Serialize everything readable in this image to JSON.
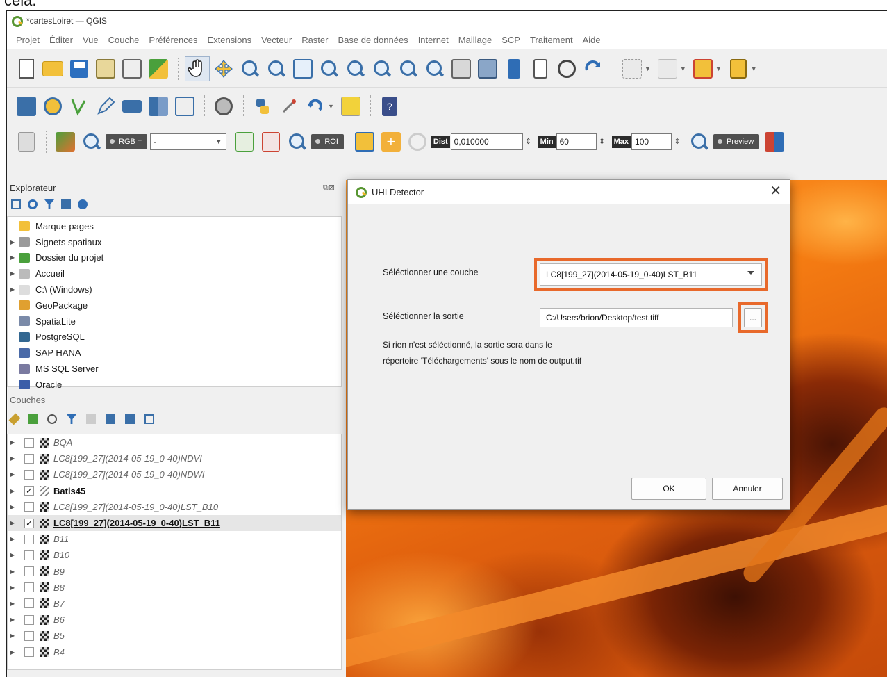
{
  "caption": "cela.",
  "window": {
    "title": "*cartesLoiret — QGIS"
  },
  "menubar": [
    "Projet",
    "Éditer",
    "Vue",
    "Couche",
    "Préférences",
    "Extensions",
    "Vecteur",
    "Raster",
    "Base de données",
    "Internet",
    "Maillage",
    "SCP",
    "Traitement",
    "Aide"
  ],
  "scp_toolbar": {
    "rgb_label": "RGB =",
    "rgb_value": "-",
    "roi_label": "ROI",
    "dist_label": "Dist",
    "dist_value": "0,010000",
    "min_label": "Min",
    "min_value": "60",
    "max_label": "Max",
    "max_value": "100",
    "preview_label": "Preview"
  },
  "explorer": {
    "title": "Explorateur",
    "items": [
      {
        "label": "Marque-pages",
        "icon": "star-icon",
        "color": "#f2c03a",
        "expand": false
      },
      {
        "label": "Signets spatiaux",
        "icon": "bookmark-icon",
        "color": "#9a9a9a",
        "expand": true
      },
      {
        "label": "Dossier du projet",
        "icon": "project-folder-icon",
        "color": "#4aa03c",
        "expand": true
      },
      {
        "label": "Accueil",
        "icon": "home-icon",
        "color": "#bbbbbb",
        "expand": true
      },
      {
        "label": "C:\\ (Windows)",
        "icon": "drive-icon",
        "color": "#dddddd",
        "expand": true
      },
      {
        "label": "GeoPackage",
        "icon": "geopackage-icon",
        "color": "#e0a030",
        "expand": false
      },
      {
        "label": "SpatiaLite",
        "icon": "spatialite-icon",
        "color": "#7a8aa8",
        "expand": false
      },
      {
        "label": "PostgreSQL",
        "icon": "postgresql-icon",
        "color": "#336791",
        "expand": false
      },
      {
        "label": "SAP HANA",
        "icon": "sap-hana-icon",
        "color": "#4a6aa8",
        "expand": false
      },
      {
        "label": "MS SQL Server",
        "icon": "mssql-icon",
        "color": "#7a7aa0",
        "expand": false
      },
      {
        "label": "Oracle",
        "icon": "oracle-icon",
        "color": "#3b5ea8",
        "expand": false
      }
    ]
  },
  "layers": {
    "title": "Couches",
    "items": [
      {
        "label": "BQA",
        "checked": false,
        "style": "italic"
      },
      {
        "label": "LC8[199_27](2014-05-19_0-40)NDVI",
        "checked": false,
        "style": "italic"
      },
      {
        "label": "LC8[199_27](2014-05-19_0-40)NDWI",
        "checked": false,
        "style": "italic"
      },
      {
        "label": "Batis45",
        "checked": true,
        "style": "bold",
        "icon": "hatch"
      },
      {
        "label": "LC8[199_27](2014-05-19_0-40)LST_B10",
        "checked": false,
        "style": "italic"
      },
      {
        "label": "LC8[199_27](2014-05-19_0-40)LST_B11",
        "checked": true,
        "style": "active"
      },
      {
        "label": "B11",
        "checked": false,
        "style": "italic"
      },
      {
        "label": "B10",
        "checked": false,
        "style": "italic"
      },
      {
        "label": "B9",
        "checked": false,
        "style": "italic"
      },
      {
        "label": "B8",
        "checked": false,
        "style": "italic"
      },
      {
        "label": "B7",
        "checked": false,
        "style": "italic"
      },
      {
        "label": "B6",
        "checked": false,
        "style": "italic"
      },
      {
        "label": "B5",
        "checked": false,
        "style": "italic"
      },
      {
        "label": "B4",
        "checked": false,
        "style": "italic"
      }
    ]
  },
  "dialog": {
    "title": "UHI Detector",
    "close": "✕",
    "layer_label": "Séléctionner une couche",
    "layer_value": "LC8[199_27](2014-05-19_0-40)LST_B11",
    "output_label": "Séléctionner la sortie",
    "output_value": "C:/Users/brion/Desktop/test.tiff",
    "browse_label": "...",
    "note_line1": "Si rien n'est séléctionné, la sortie sera dans le",
    "note_line2": "répertoire 'Téléchargements' sous le nom de output.tif",
    "ok_label": "OK",
    "cancel_label": "Annuler",
    "highlight_color": "#e8692b"
  }
}
